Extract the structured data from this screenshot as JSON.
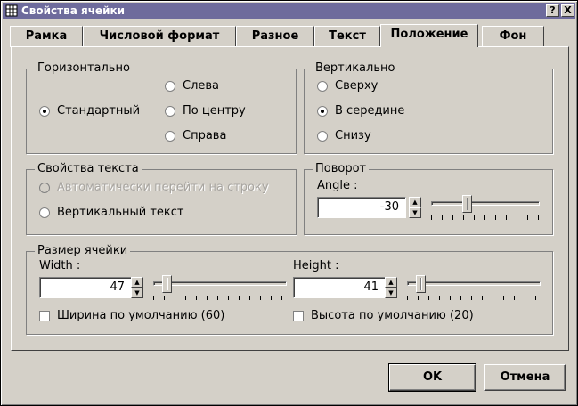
{
  "window": {
    "title": "Свойства ячейки",
    "help": "?",
    "close": "X"
  },
  "tabs": [
    {
      "label": "Рамка",
      "active": false
    },
    {
      "label": "Числовой формат",
      "active": false
    },
    {
      "label": "Разное",
      "active": false
    },
    {
      "label": "Текст",
      "active": false
    },
    {
      "label": "Положение",
      "active": true
    },
    {
      "label": "Фон",
      "active": false
    }
  ],
  "horizontal": {
    "title": "Горизонтально",
    "options": [
      {
        "label": "Стандартный",
        "checked": true
      },
      {
        "label": "Слева",
        "checked": false
      },
      {
        "label": "По центру",
        "checked": false
      },
      {
        "label": "Справа",
        "checked": false
      }
    ]
  },
  "vertical": {
    "title": "Вертикально",
    "options": [
      {
        "label": "Сверху",
        "checked": false
      },
      {
        "label": "В середине",
        "checked": true
      },
      {
        "label": "Снизу",
        "checked": false
      }
    ]
  },
  "text_props": {
    "title": "Свойства текста",
    "wrap": {
      "label": "Автоматически перейти на строку",
      "enabled": false
    },
    "vertical": {
      "label": "Вертикальный текст",
      "checked": false
    }
  },
  "rotation": {
    "title": "Поворот",
    "label": "Angle :",
    "value": "-30"
  },
  "cell_size": {
    "title": "Размер ячейки",
    "width_label": "Width :",
    "width_value": "47",
    "height_label": "Height :",
    "height_value": "41",
    "default_width": "Ширина по умолчанию (60)",
    "default_height": "Высота по умолчанию (20)"
  },
  "buttons": {
    "ok": "OK",
    "cancel": "Отмена"
  },
  "colors": {
    "titlebar": "#6e6b9c",
    "face": "#d4d0c8"
  }
}
